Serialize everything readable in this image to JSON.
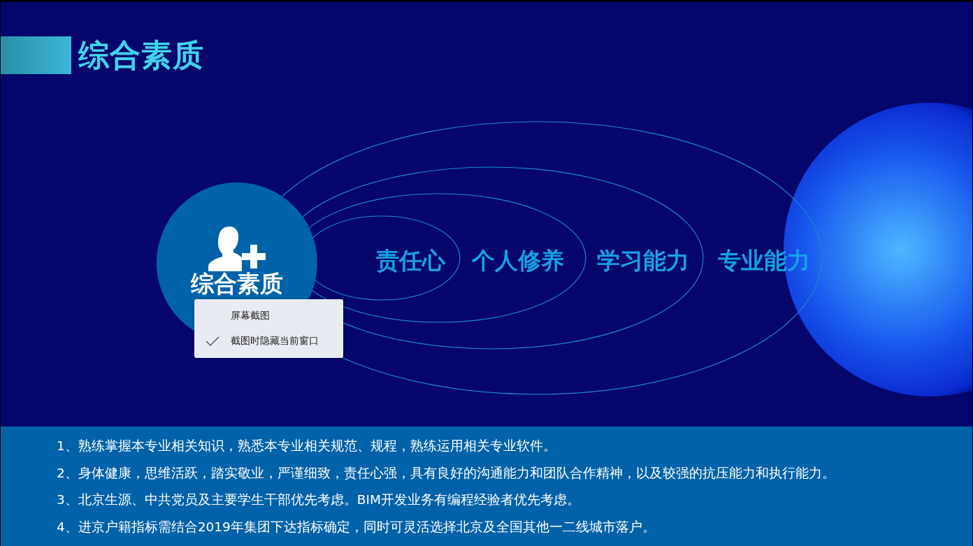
{
  "slide": {
    "title": "综合素质",
    "center": {
      "label": "综合素质"
    },
    "rings": [
      "责任心",
      "个人修养",
      "学习能力",
      "专业能力"
    ],
    "requirements": [
      "1、熟练掌握本专业相关知识，熟悉本专业相关规范、规程，熟练运用相关专业软件。",
      "2、身体健康，思维活跃，踏实敬业，严谨细致，责任心强，具有良好的沟通能力和团队合作精神，以及较强的抗压能力和执行能力。",
      "3、北京生源、中共党员及主要学生干部优先考虑。BIM开发业务有编程经验者优先考虑。",
      "4、进京户籍指标需结合2019年集团下达指标确定，同时可灵活选择北京及全国其他一二线城市落户。"
    ]
  },
  "context_menu": {
    "items": [
      {
        "label": "屏幕截图",
        "checked": false
      },
      {
        "label": "截图时隐藏当前窗口",
        "checked": true
      }
    ]
  }
}
